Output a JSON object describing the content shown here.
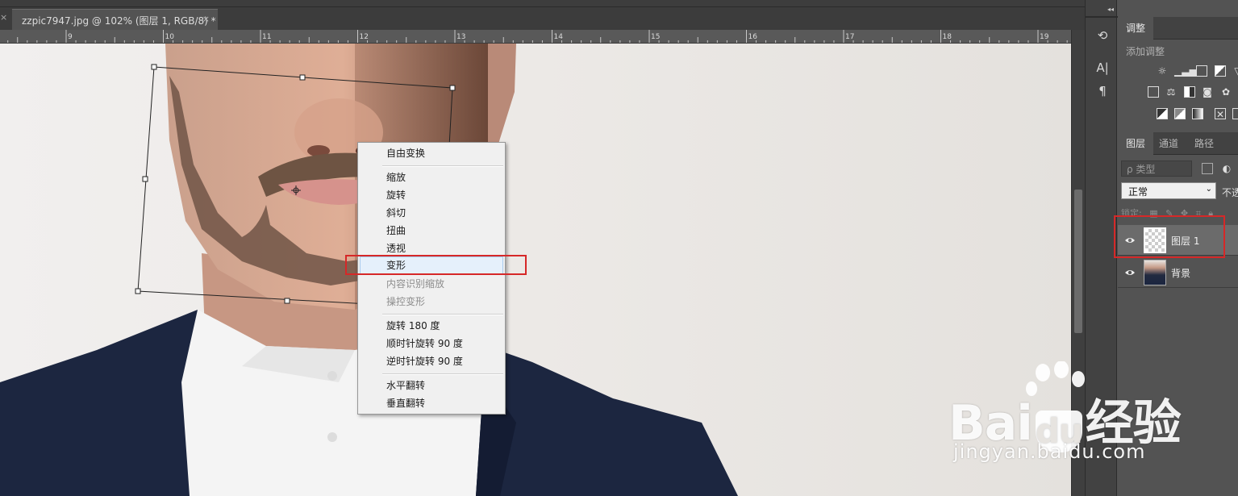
{
  "document": {
    "prev_tab_close": "×",
    "tab_title": "zzpic7947.jpg @ 102% (图层 1, RGB/8) *",
    "tab_close": "×"
  },
  "ruler": {
    "labels": [
      "9",
      "10",
      "11",
      "12",
      "13",
      "14",
      "15",
      "16",
      "17",
      "18",
      "19"
    ]
  },
  "context_menu": {
    "items": [
      {
        "label": "自由变换",
        "enabled": true
      },
      {
        "label": "缩放",
        "enabled": true
      },
      {
        "label": "旋转",
        "enabled": true
      },
      {
        "label": "斜切",
        "enabled": true
      },
      {
        "label": "扭曲",
        "enabled": true
      },
      {
        "label": "透视",
        "enabled": true
      },
      {
        "label": "变形",
        "enabled": true,
        "highlighted": true
      },
      {
        "label": "内容识别缩放",
        "enabled": false
      },
      {
        "label": "操控变形",
        "enabled": false
      },
      {
        "label": "旋转 180 度",
        "enabled": true
      },
      {
        "label": "顺时针旋转 90 度",
        "enabled": true
      },
      {
        "label": "逆时针旋转 90 度",
        "enabled": true
      },
      {
        "label": "水平翻转",
        "enabled": true
      },
      {
        "label": "垂直翻转",
        "enabled": true
      }
    ]
  },
  "tool_strip": {
    "collapse_glyph": "◂◂",
    "tools": [
      {
        "icon": "history-icon",
        "glyph": "⟲"
      },
      {
        "icon": "character-icon",
        "glyph": "A|"
      },
      {
        "icon": "paragraph-icon",
        "glyph": "¶"
      }
    ]
  },
  "adjustments_panel": {
    "tab": "调整",
    "title": "添加调整"
  },
  "layers_panel": {
    "tabs": [
      "图层",
      "通道",
      "路径"
    ],
    "active_tab": "图层",
    "filter_placeholder": "ρ 类型",
    "blend_mode": "正常",
    "opacity_label": "不透",
    "lock_label": "锁定:",
    "layers": [
      {
        "name": "图层 1",
        "visible": true,
        "selected": true,
        "thumb": "transparent"
      },
      {
        "name": "背景",
        "visible": true,
        "selected": false,
        "thumb": "photo"
      }
    ]
  },
  "watermark": {
    "brand": "Bai",
    "brand_suffix": "经验",
    "url": "jingyan.baidu.com"
  },
  "colors": {
    "highlight_box": "#d62828",
    "menu_hover": "#e5f0fb",
    "suit": "#1c2640",
    "skin": "#d9a48e",
    "beard": "#6e5443"
  }
}
